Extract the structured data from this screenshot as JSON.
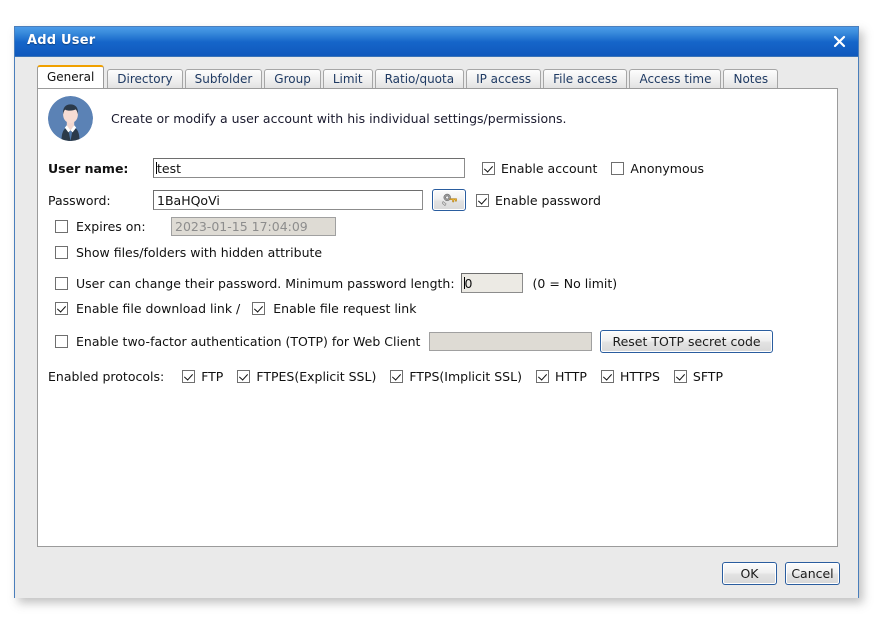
{
  "window": {
    "title": "Add User",
    "close_label": "close"
  },
  "tabs": [
    {
      "label": "General",
      "active": true
    },
    {
      "label": "Directory",
      "active": false
    },
    {
      "label": "Subfolder",
      "active": false
    },
    {
      "label": "Group",
      "active": false
    },
    {
      "label": "Limit",
      "active": false
    },
    {
      "label": "Ratio/quota",
      "active": false
    },
    {
      "label": "IP access",
      "active": false
    },
    {
      "label": "File access",
      "active": false
    },
    {
      "label": "Access time",
      "active": false
    },
    {
      "label": "Notes",
      "active": false
    }
  ],
  "general": {
    "description": "Create or modify a user account with his individual settings/permissions.",
    "username_label": "User name:",
    "username_value": "test",
    "enable_account_label": "Enable account",
    "anonymous_label": "Anonymous",
    "password_label": "Password:",
    "password_value": "1BaHQoVi",
    "generate_password_icon": "key-icon",
    "enable_password_label": "Enable password",
    "expires_on_label": "Expires on:",
    "expires_on_value": "2023-01-15 17:04:09",
    "show_hidden_label": "Show files/folders with hidden attribute",
    "user_change_password_label": "User can change their password. Minimum password length:",
    "min_password_length_value": "0",
    "no_limit_note": "(0 = No limit)",
    "download_link_label": "Enable file download link /",
    "request_link_label": "Enable file request link",
    "totp_label": "Enable two-factor authentication (TOTP) for Web Client",
    "totp_secret_value": "",
    "reset_totp_label": "Reset TOTP secret code",
    "protocols_label": "Enabled protocols:",
    "protocols": [
      {
        "label": "FTP",
        "checked": true
      },
      {
        "label": "FTPES(Explicit SSL)",
        "checked": true
      },
      {
        "label": "FTPS(Implicit SSL)",
        "checked": true
      },
      {
        "label": "HTTP",
        "checked": true
      },
      {
        "label": "HTTPS",
        "checked": true
      },
      {
        "label": "SFTP",
        "checked": true
      }
    ],
    "checkbox_states": {
      "enable_account": true,
      "anonymous": false,
      "enable_password": true,
      "expires_on": false,
      "show_hidden": false,
      "user_change_password": false,
      "download_link": true,
      "request_link": true,
      "totp": false
    }
  },
  "footer": {
    "ok_label": "OK",
    "cancel_label": "Cancel"
  },
  "colors": {
    "titlebar_start": "#4a9ae8",
    "titlebar_end": "#1059bd",
    "window_border": "#4a7ebb",
    "active_tab_accent": "#f0a000",
    "panel_bg": "#ffffff",
    "body_bg": "#eaeaea",
    "avatar_bg": "#5b82b5"
  }
}
